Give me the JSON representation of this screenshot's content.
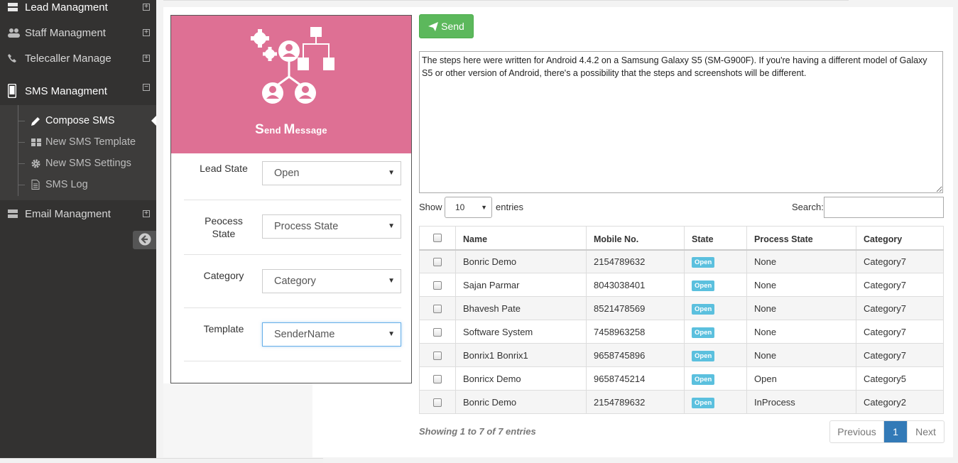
{
  "sidebar": {
    "items": [
      {
        "label": "Lead Managment",
        "icon": "server-icon"
      },
      {
        "label": "Staff Managment",
        "icon": "users-icon"
      },
      {
        "label": "Telecaller Manage",
        "icon": "phone-icon"
      },
      {
        "label": "SMS Managment",
        "icon": "mobile-icon"
      },
      {
        "label": "Email Managment",
        "icon": "server-icon"
      }
    ],
    "sms_sub": [
      {
        "label": "Compose SMS",
        "icon": "pencil-icon"
      },
      {
        "label": "New SMS Template",
        "icon": "grid-icon"
      },
      {
        "label": "New SMS Settings",
        "icon": "gear-icon"
      },
      {
        "label": "SMS Log",
        "icon": "file-icon"
      }
    ]
  },
  "panel": {
    "title_first": "S",
    "title_first_rest": "end",
    "title_second": "M",
    "title_second_rest": "essage",
    "header_color": "#de7094",
    "fields": [
      {
        "label": "Lead State",
        "value": "Open"
      },
      {
        "label": "Peocess State",
        "value": "Process State"
      },
      {
        "label": "Category",
        "value": "Category"
      },
      {
        "label": "Template",
        "value": "SenderName"
      }
    ]
  },
  "toolbar": {
    "send_label": "Send"
  },
  "message": "The steps here were written for Android 4.4.2 on a Samsung Galaxy S5 (SM-G900F). If you're having a different model of Galaxy S5 or other version of Android, there's a possibility that the steps and screenshots will be different.",
  "table_controls": {
    "show_label": "Show",
    "entries_label": "entries",
    "page_length": "10",
    "search_label": "Search:"
  },
  "table": {
    "headers": [
      "Name",
      "Mobile No.",
      "State",
      "Process State",
      "Category"
    ],
    "rows": [
      {
        "name": "Bonric Demo",
        "mobile": "2154789632",
        "state": "Open",
        "process": "None",
        "category": "Category7"
      },
      {
        "name": "Sajan Parmar",
        "mobile": "8043038401",
        "state": "Open",
        "process": "None",
        "category": "Category7"
      },
      {
        "name": "Bhavesh Pate",
        "mobile": "8521478569",
        "state": "Open",
        "process": "None",
        "category": "Category7"
      },
      {
        "name": "Software System",
        "mobile": "7458963258",
        "state": "Open",
        "process": "None",
        "category": "Category7"
      },
      {
        "name": "Bonrix1 Bonrix1",
        "mobile": "9658745896",
        "state": "Open",
        "process": "None",
        "category": "Category7"
      },
      {
        "name": "Bonricx Demo",
        "mobile": "9658745214",
        "state": "Open",
        "process": "Open",
        "category": "Category5"
      },
      {
        "name": "Bonric Demo",
        "mobile": "2154789632",
        "state": "Open",
        "process": "InProcess",
        "category": "Category2"
      }
    ]
  },
  "pagination": {
    "info": "Showing 1 to 7 of 7 entries",
    "prev": "Previous",
    "current": "1",
    "next": "Next"
  },
  "colors": {
    "sidebar": "#333231",
    "send_button": "#5cb85c",
    "badge": "#5bc0de",
    "page_active": "#337ab7"
  }
}
